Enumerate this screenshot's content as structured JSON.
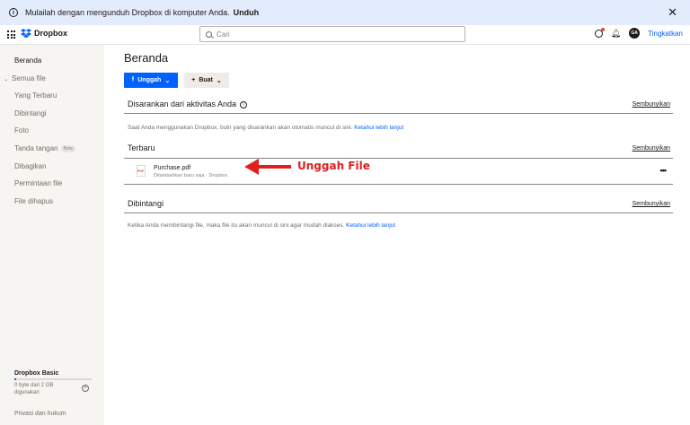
{
  "banner": {
    "message": "Mulailah dengan mengunduh Dropbox di komputer Anda.",
    "link": "Unduh",
    "close": "✕"
  },
  "header": {
    "brand": "Dropbox",
    "search_placeholder": "Cari",
    "avatar_initials": "GA",
    "upgrade": "Tingkatkan"
  },
  "sidebar": {
    "items": [
      {
        "label": "Beranda"
      },
      {
        "label": "Semua file"
      },
      {
        "label": "Yang Terbaru"
      },
      {
        "label": "Dibintangi"
      },
      {
        "label": "Foto"
      },
      {
        "label": "Tanda tangan",
        "badge": "Beta"
      },
      {
        "label": "Dibagikan"
      },
      {
        "label": "Permintaan file"
      },
      {
        "label": "File dihapus"
      }
    ],
    "plan": "Dropbox Basic",
    "usage": "0 byte dari 2 GB digunakan",
    "usage_fraction": 0.0,
    "privacy": "Privasi dan hukum"
  },
  "main": {
    "title": "Beranda",
    "upload_label": "Unggah",
    "create_label": "Buat",
    "suggested": {
      "title": "Disarankan dari aktivitas Anda",
      "action": "Sembunyikan",
      "text": "Saat Anda menggunakan Dropbox, butir yang disarankan akan otomatis muncul di sini.",
      "link": "Ketahui lebih lanjut"
    },
    "recent": {
      "title": "Terbaru",
      "action": "Sembunyikan",
      "files": [
        {
          "name": "Purchase.pdf",
          "meta": "Ditambahkan baru saja · Dropbox"
        }
      ]
    },
    "starred": {
      "title": "Dibintangi",
      "action": "Sembunyikan",
      "text": "Ketika Anda membintangi file, maka file itu akan muncul di sini agar mudah diakses.",
      "link": "Ketahui lebih lanjut"
    }
  },
  "annotation": {
    "label": "Unggah File",
    "color": "#e02020"
  },
  "colors": {
    "accent": "#0061fe",
    "banner_bg": "#e3ecfc",
    "sidebar_bg": "#f7f5f2"
  }
}
